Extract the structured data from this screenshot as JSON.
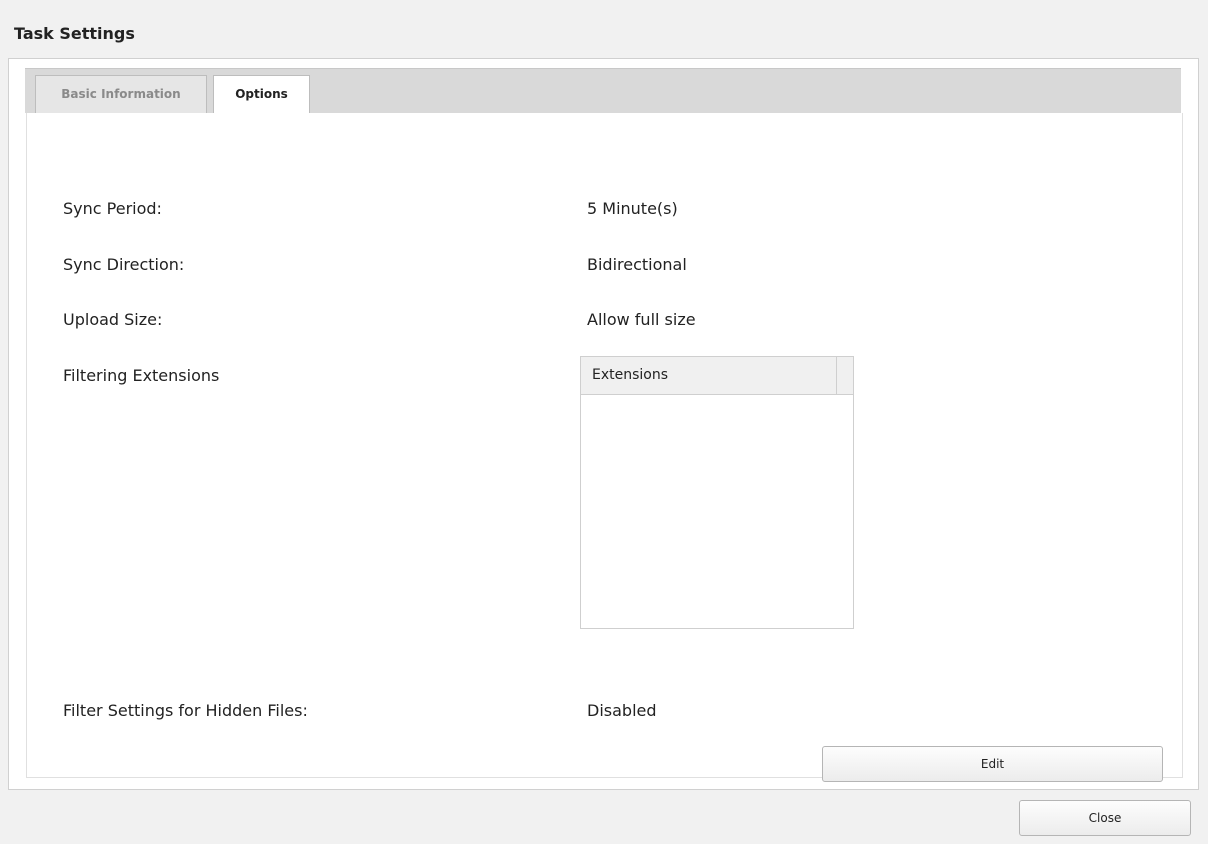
{
  "dialog": {
    "title": "Task Settings"
  },
  "tabs": [
    {
      "label": "Basic Information",
      "active": false
    },
    {
      "label": "Options",
      "active": true
    }
  ],
  "options": {
    "sync_period": {
      "label": "Sync Period:",
      "value": "5 Minute(s)"
    },
    "sync_direction": {
      "label": "Sync Direction:",
      "value": "Bidirectional"
    },
    "upload_size": {
      "label": "Upload Size:",
      "value": "Allow full size"
    },
    "filtering_extensions": {
      "label": "Filtering Extensions",
      "column_header": "Extensions",
      "rows": []
    },
    "hidden_files": {
      "label": "Filter Settings for Hidden Files:",
      "value": "Disabled"
    }
  },
  "buttons": {
    "edit": "Edit",
    "close": "Close"
  }
}
